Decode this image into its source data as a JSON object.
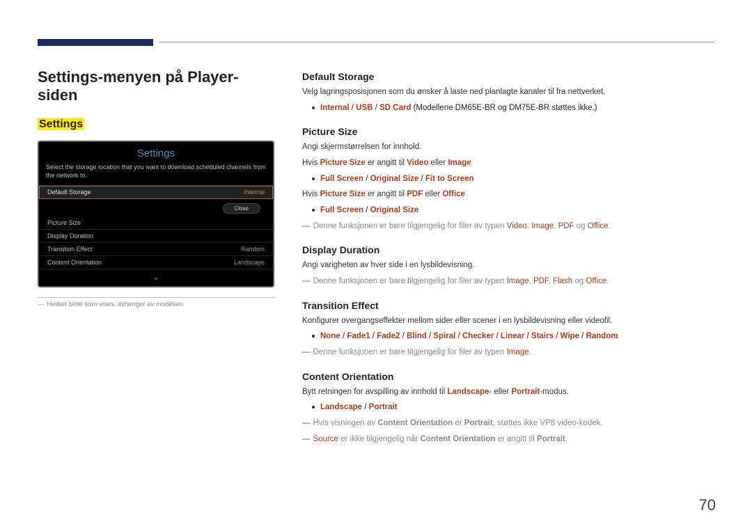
{
  "page_number": "70",
  "page_title": "Settings-menyen på Player-siden",
  "highlight_label": "Settings",
  "device_shot": {
    "title": "Settings",
    "help": "Select the storage location that you want to download scheduled channels from the network to.",
    "close": "Close",
    "rows": [
      {
        "label": "Default Storage",
        "value": "Internal",
        "selected": true
      },
      {
        "label": "Picture Size",
        "value": "",
        "selected": false
      },
      {
        "label": "Display Duration",
        "value": "",
        "selected": false
      },
      {
        "label": "Transition Effect",
        "value": "Random",
        "selected": false
      },
      {
        "label": "Content Orientation",
        "value": "Landscape",
        "selected": false
      }
    ]
  },
  "left_footnote": "Hvilket bilde som vises, avhenger av modellen.",
  "sections": {
    "default_storage": {
      "h": "Default Storage",
      "p1": "Velg lagringsposisjonen som du ønsker å laste ned planlagte kanaler til fra nettverket.",
      "opts": [
        "Internal",
        "USB",
        "SD Card"
      ],
      "opts_note": " (Modellene DM65E-BR og DM75E-BR støttes ikke.)"
    },
    "picture_size": {
      "h": "Picture Size",
      "p1": "Angi skjermstørrelsen for innhold.",
      "line2_pre": "Hvis ",
      "line2_ps": "Picture Size",
      "line2_mid": " er angitt til ",
      "line2_v": "Video",
      "line2_or": " eller ",
      "line2_i": "Image",
      "opts_a": [
        "Full Screen",
        "Original Size",
        "Fit to Screen"
      ],
      "line4_pdf": "PDF",
      "line4_office": "Office",
      "opts_b": [
        "Full Screen",
        "Original Size"
      ],
      "note_pre": "Denne funksjonen er bare tilgjengelig for filer av typen ",
      "note_types": [
        "Video",
        "Image",
        "PDF",
        "Office"
      ],
      "note_og": " og "
    },
    "display_duration": {
      "h": "Display Duration",
      "p1": "Angi varigheten av hver side i en lysbildevisning.",
      "note_types": [
        "Image",
        "PDF",
        "Flash",
        "Office"
      ]
    },
    "transition_effect": {
      "h": "Transition Effect",
      "p1": "Konfigurer overgangseffekter mellom sider eller scener i en lysbildevisning eller videofil.",
      "opts": [
        "None",
        "Fade1",
        "Fade2",
        "Blind",
        "Spiral",
        "Checker",
        "Linear",
        "Stairs",
        "Wipe",
        "Random"
      ],
      "note_types": [
        "Image"
      ]
    },
    "content_orientation": {
      "h": "Content Orientation",
      "p1_pre": "Bytt retningen for avspilling av innhold til ",
      "p1_l": "Landscape",
      "p1_mid": "- eller ",
      "p1_p": "Portrait",
      "p1_post": "-modus.",
      "opts": [
        "Landscape",
        "Portrait"
      ],
      "note1_pre": "Hvis visningen av ",
      "note1_co": "Content Orientation",
      "note1_mid": " er ",
      "note1_p": "Portrait",
      "note1_post": ", støttes ikke VP8 video-kodek.",
      "note2_s": "Source",
      "note2_mid": " er ikke tilgjengelig når ",
      "note2_post": " er angitt til "
    }
  }
}
